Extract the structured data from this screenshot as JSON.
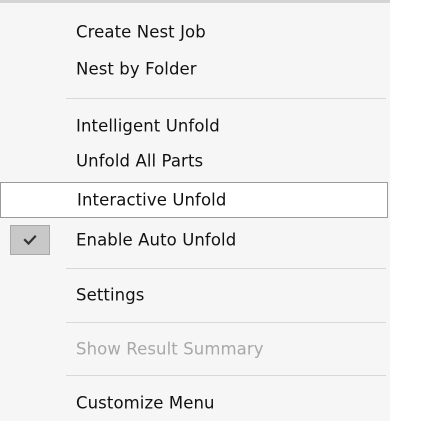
{
  "menu": {
    "items": [
      {
        "id": "create-nest-job",
        "label": "Create Nest Job"
      },
      {
        "id": "nest-by-folder",
        "label": "Nest by Folder"
      },
      {
        "id": "intelligent-unfold",
        "label": "Intelligent Unfold"
      },
      {
        "id": "unfold-all-parts",
        "label": "Unfold All Parts"
      },
      {
        "id": "interactive-unfold",
        "label": "Interactive Unfold",
        "highlighted": true
      },
      {
        "id": "enable-auto-unfold",
        "label": "Enable Auto Unfold",
        "checked": true
      },
      {
        "id": "settings",
        "label": "Settings"
      },
      {
        "id": "show-result-summary",
        "label": "Show Result Summary",
        "disabled": true
      },
      {
        "id": "customize-menu",
        "label": "Customize Menu"
      }
    ],
    "check_icon": "checkmark-icon",
    "colors": {
      "background": "#f6f6f6",
      "highlight_border": "#9a9a9a",
      "disabled_text": "#a8a8a8",
      "check_box": "#c8c8c8"
    }
  }
}
